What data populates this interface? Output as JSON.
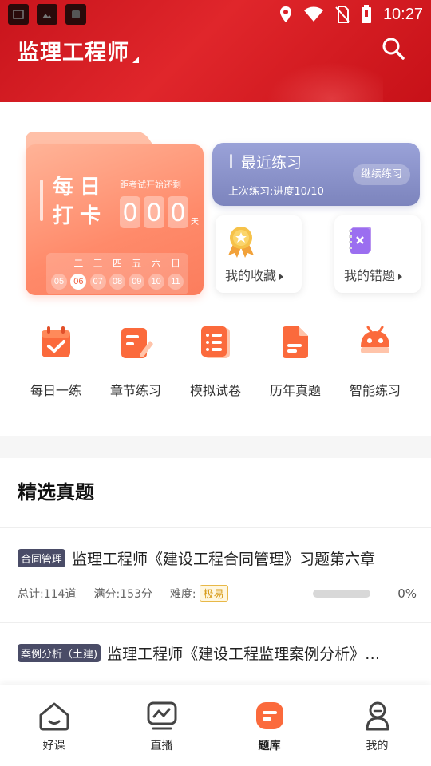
{
  "status_bar": {
    "time": "10:27"
  },
  "header": {
    "title": "监理工程师"
  },
  "checkin": {
    "title": "每日打卡",
    "countdown_label": "距考试开始还剩",
    "digits": [
      "0",
      "0",
      "0"
    ],
    "unit": "天",
    "weekdays": [
      "一",
      "二",
      "三",
      "四",
      "五",
      "六",
      "日"
    ],
    "dates": [
      "05",
      "06",
      "07",
      "08",
      "09",
      "10",
      "11"
    ]
  },
  "recent": {
    "title": "最近练习",
    "subtitle": "上次练习:进度10/10",
    "continue_label": "继续练习"
  },
  "favorites": {
    "label": "我的收藏"
  },
  "wrong": {
    "label": "我的错题"
  },
  "functions": [
    {
      "label": "每日一练",
      "icon": "calendar-check-icon"
    },
    {
      "label": "章节练习",
      "icon": "edit-note-icon"
    },
    {
      "label": "模拟试卷",
      "icon": "list-paper-icon"
    },
    {
      "label": "历年真题",
      "icon": "document-icon"
    },
    {
      "label": "智能练习",
      "icon": "robot-icon"
    }
  ],
  "featured": {
    "title": "精选真题",
    "items": [
      {
        "tag": "合同管理",
        "title": "监理工程师《建设工程合同管理》习题第六章",
        "total": "总计:114道",
        "score": "满分:153分",
        "difficulty_label": "难度:",
        "difficulty": "极易",
        "progress": 0,
        "percent": "0%"
      },
      {
        "tag": "案例分析（土建)",
        "title": "监理工程师《建设工程监理案例分析》…"
      }
    ]
  },
  "bottom_nav": [
    {
      "label": "好课",
      "icon": "home-icon"
    },
    {
      "label": "直播",
      "icon": "live-tv-icon"
    },
    {
      "label": "题库",
      "icon": "question-bank-icon",
      "active": true
    },
    {
      "label": "我的",
      "icon": "profile-icon"
    }
  ],
  "colors": {
    "header_red": "#d91f26",
    "accent_orange": "#f06a3a",
    "recent_purple": "#8a91c9",
    "badge_gold": "#d79b18"
  }
}
